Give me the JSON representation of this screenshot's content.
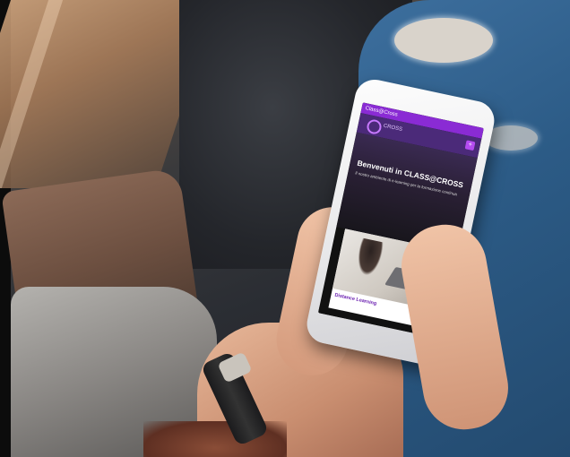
{
  "phone_app": {
    "status_bar_text": "Class@Cross",
    "logo_text": "CROSS",
    "menu_icon": "plus-icon",
    "hero_title": "Benvenuti in CLASS@CROSS",
    "hero_subtitle": "Il nostro ambiente di e-learning per la formazione continua",
    "card_title": "Distance Learning"
  },
  "colors": {
    "accent_purple": "#8a2bd4",
    "header_purple": "#4b2a79",
    "card_title": "#6a1fb0"
  }
}
